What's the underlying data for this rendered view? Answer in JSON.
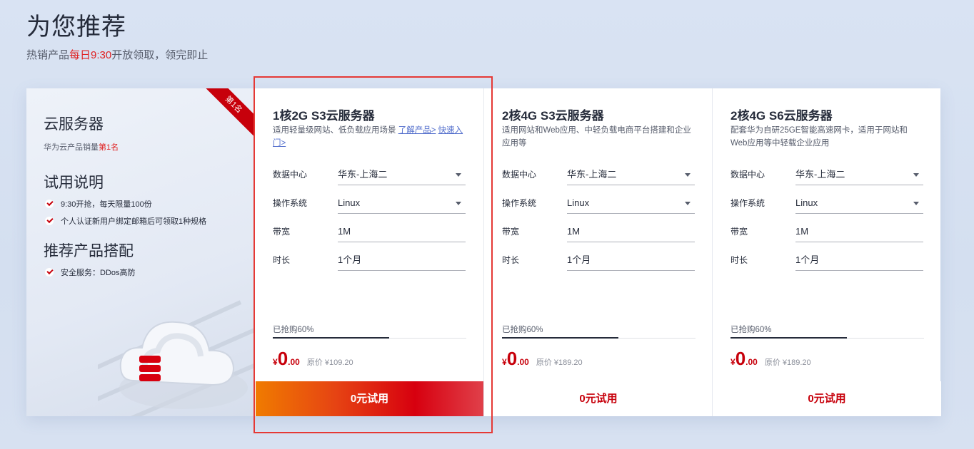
{
  "header": {
    "title": "为您推荐",
    "subtitle_before": "热销产品",
    "subtitle_highlight": "每日9:30",
    "subtitle_after": "开放领取，领完即止"
  },
  "sidebar": {
    "ribbon": "第1名",
    "cloud_heading": "云服务器",
    "cloud_note_before": "华为云产品销量",
    "cloud_note_highlight": "第1名",
    "trial_heading": "试用说明",
    "trial_items": [
      "9:30开抢，每天限量100份",
      "个人认证新用户绑定邮箱后可领取1种规格"
    ],
    "combo_heading": "推荐产品搭配",
    "combo_items": [
      "安全服务：DDos高防"
    ]
  },
  "labels": {
    "datacenter": "数据中心",
    "os": "操作系统",
    "bandwidth": "带宽",
    "duration": "时长"
  },
  "cards": [
    {
      "title": "1核2G S3云服务器",
      "desc": "适用轻量级网站、低负载应用场景 ",
      "link1": "了解产品>",
      "link2": "快速入门>",
      "datacenter": "华东-上海二",
      "os": "Linux",
      "bandwidth": "1M",
      "duration": "1个月",
      "progress_label": "已抢购60%",
      "progress": 0.6,
      "currency": "¥",
      "price_int": "0",
      "price_dec": ".00",
      "orig_price": "原价 ¥109.20",
      "button": "0元试用"
    },
    {
      "title": "2核4G S3云服务器",
      "desc": "适用网站和Web应用、中轻负载电商平台搭建和企业应用等",
      "datacenter": "华东-上海二",
      "os": "Linux",
      "bandwidth": "1M",
      "duration": "1个月",
      "progress_label": "已抢购60%",
      "progress": 0.6,
      "currency": "¥",
      "price_int": "0",
      "price_dec": ".00",
      "orig_price": "原价 ¥189.20",
      "button": "0元试用"
    },
    {
      "title": "2核4G S6云服务器",
      "desc": "配套华为自研25GE智能高速网卡，适用于网站和Web应用等中轻载企业应用",
      "datacenter": "华东-上海二",
      "os": "Linux",
      "bandwidth": "1M",
      "duration": "1个月",
      "progress_label": "已抢购60%",
      "progress": 0.6,
      "currency": "¥",
      "price_int": "0",
      "price_dec": ".00",
      "orig_price": "原价 ¥189.20",
      "button": "0元试用"
    }
  ],
  "colors": {
    "brand_red": "#c7000b",
    "highlight_red": "#e02020",
    "selection_border": "#e53935"
  }
}
